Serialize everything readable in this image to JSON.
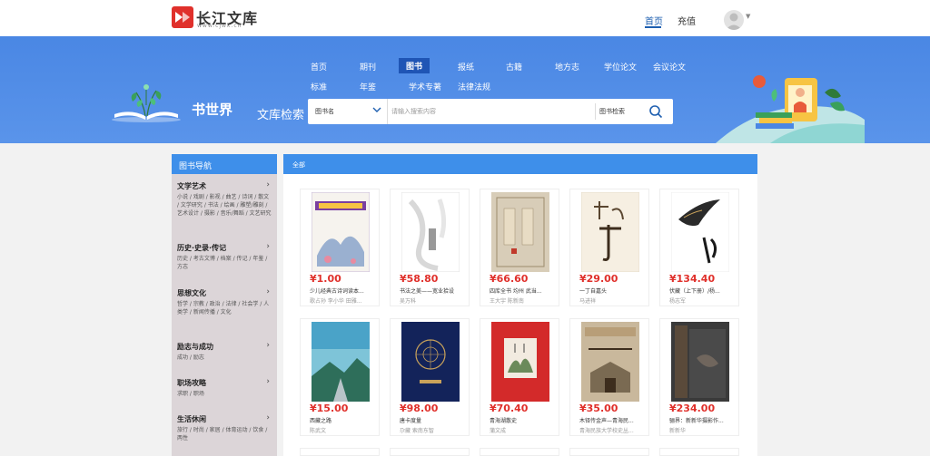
{
  "header": {
    "logo_text": "长江文库",
    "logo_url": "www.cjwk.cn",
    "nav_home": "首页",
    "nav_recharge": "充值"
  },
  "banner": {
    "categories_row1": [
      "首页",
      "期刊",
      "图书",
      "报纸",
      "古籍",
      "地方志",
      "学位论文",
      "会议论文"
    ],
    "categories_row2": [
      "标准",
      "年鉴",
      "学术专著",
      "法律法规"
    ],
    "active_category": "图书",
    "brand_title": "书世界",
    "search_label": "文库检索",
    "search_type": "图书名",
    "search_placeholder": "请输入搜索内容",
    "search_button": "图书检索",
    "accent_color": "#4a87e4"
  },
  "sidebar": {
    "title": "图书导航",
    "groups": [
      {
        "title": "文学艺术",
        "sub": "小说 / 戏剧 / 影视 / 曲艺 / 诗词 / 散文 / 文学研究 / 书法 / 绘画 / 雕塑/雕刻 / 艺术设计 / 摄影 / 音乐/舞蹈 / 文艺研究"
      },
      {
        "title": "历史·史录·传记",
        "sub": "历史 / 考古文博 / 档案 / 传记 / 年鉴 / 方志"
      },
      {
        "title": "思想文化",
        "sub": "哲学 / 宗教 / 政治 / 法律 / 社会学 / 人类学 / 新闻传播 / 文化"
      },
      {
        "title": "励志与成功",
        "sub": "成功 / 励志"
      },
      {
        "title": "职场攻略",
        "sub": "求职 / 职场"
      },
      {
        "title": "生活休闲",
        "sub": "旅行 / 时尚 / 家居 / 体育运动 / 饮食 / 两性"
      }
    ]
  },
  "content": {
    "tab_label": "全部",
    "books": [
      {
        "price": "¥1.00",
        "title": "少儿经典古诗词读本...",
        "author": "歌占孙 李小华 田雅..."
      },
      {
        "price": "¥58.80",
        "title": "书法之美——宽业拾设",
        "author": "吴万科"
      },
      {
        "price": "¥66.60",
        "title": "四库全书 均州 武当...",
        "author": "王大宇 陈新南"
      },
      {
        "price": "¥29.00",
        "title": "一丁自嘉头",
        "author": "马进祥"
      },
      {
        "price": "¥134.40",
        "title": "伏藏（上下册）/杨...",
        "author": "杨志军"
      },
      {
        "price": "¥15.00",
        "title": "西藏之路",
        "author": "陈武文"
      },
      {
        "price": "¥98.00",
        "title": "唐卡度量",
        "author": "尕藏 索南东智"
      },
      {
        "price": "¥70.40",
        "title": "青海湖散史",
        "author": "蒲文成"
      },
      {
        "price": "¥35.00",
        "title": "木铎传金声—青海民...",
        "author": "青海民族大学校史丛..."
      },
      {
        "price": "¥234.00",
        "title": "骊界：新新华摄影作...",
        "author": "新新华"
      }
    ]
  }
}
